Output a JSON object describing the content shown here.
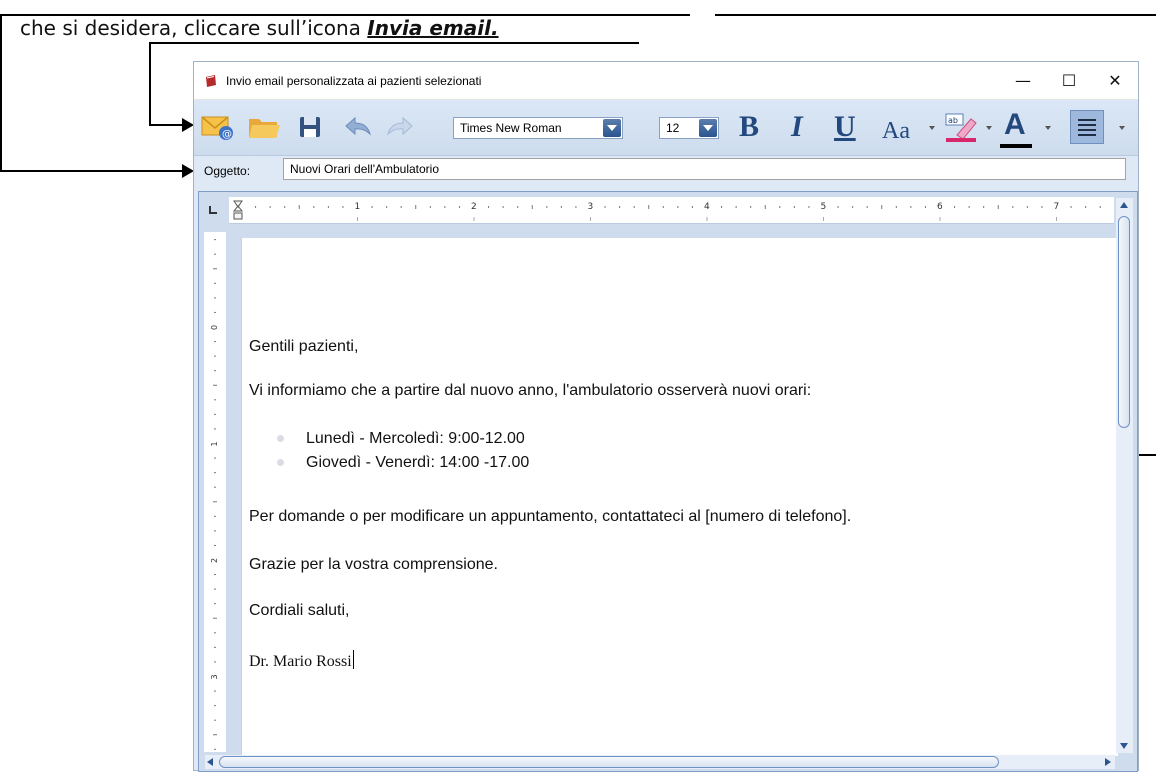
{
  "caption": {
    "prefix": "che si desidera, cliccare sull’icona ",
    "emphasis": "Invia email."
  },
  "window": {
    "title": "Invio email personalizzata ai pazienti selezionati",
    "minimize": "—",
    "maximize": "☐",
    "close": "✕"
  },
  "toolbar": {
    "font_family": "Times New Roman",
    "font_size": "12",
    "bold": "B",
    "italic": "I",
    "underline": "U",
    "change_case": "Aa",
    "font_color": "A"
  },
  "subject": {
    "label": "Oggetto:",
    "value": "Nuovi Orari dell'Ambulatorio"
  },
  "ruler": {
    "h_numbers": [
      "1",
      "2",
      "3",
      "4",
      "5",
      "6",
      "7"
    ],
    "v_numbers": [
      "0",
      "1",
      "2",
      "3"
    ]
  },
  "document": {
    "greeting": "Gentili pazienti,",
    "intro": "Vi informiamo che  a  partire dal nuovo anno,  l'ambulatorio osserverà  nuovi orari:",
    "schedule": [
      "Lunedì  -  Mercoledì:  9:00-12.00",
      "Giovedì -  Venerdì:  14:00 -17.00"
    ],
    "contact": "Per  domande o per modificare un appuntamento, contattateci al [numero di telefono].",
    "thanks": "Grazie  per la vostra comprensione.",
    "closing": "Cordiali saluti,",
    "signature": "Dr. Mario Rossi"
  },
  "colors": {
    "toolbar_bg": "#d4e2f3",
    "accent": "#22487e",
    "highlighter": "#d6286b"
  }
}
